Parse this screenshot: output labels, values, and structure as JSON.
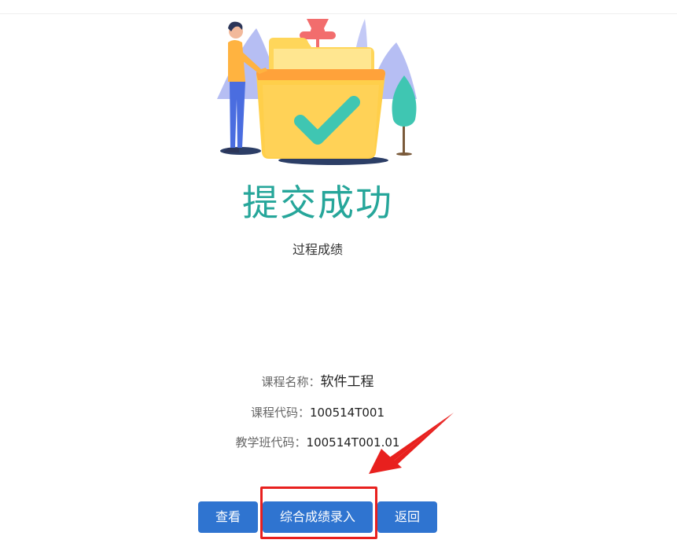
{
  "result": {
    "title": "提交成功",
    "subtitle": "过程成绩"
  },
  "course_info": {
    "name_label": "课程名称：",
    "name_value": "软件工程",
    "code_label": "课程代码：",
    "code_value": "100514T001",
    "class_code_label": "教学班代码：",
    "class_code_value": "100514T001.01"
  },
  "actions": {
    "view_label": "查看",
    "entry_label": "综合成绩录入",
    "back_label": "返回"
  },
  "colors": {
    "title": "#26a69a",
    "button": "#2f74d0",
    "annotation": "#e8201e"
  },
  "icons": {
    "illustration": "success-folder-checkmark-illustration",
    "annotation_arrow": "red-arrow-icon"
  }
}
